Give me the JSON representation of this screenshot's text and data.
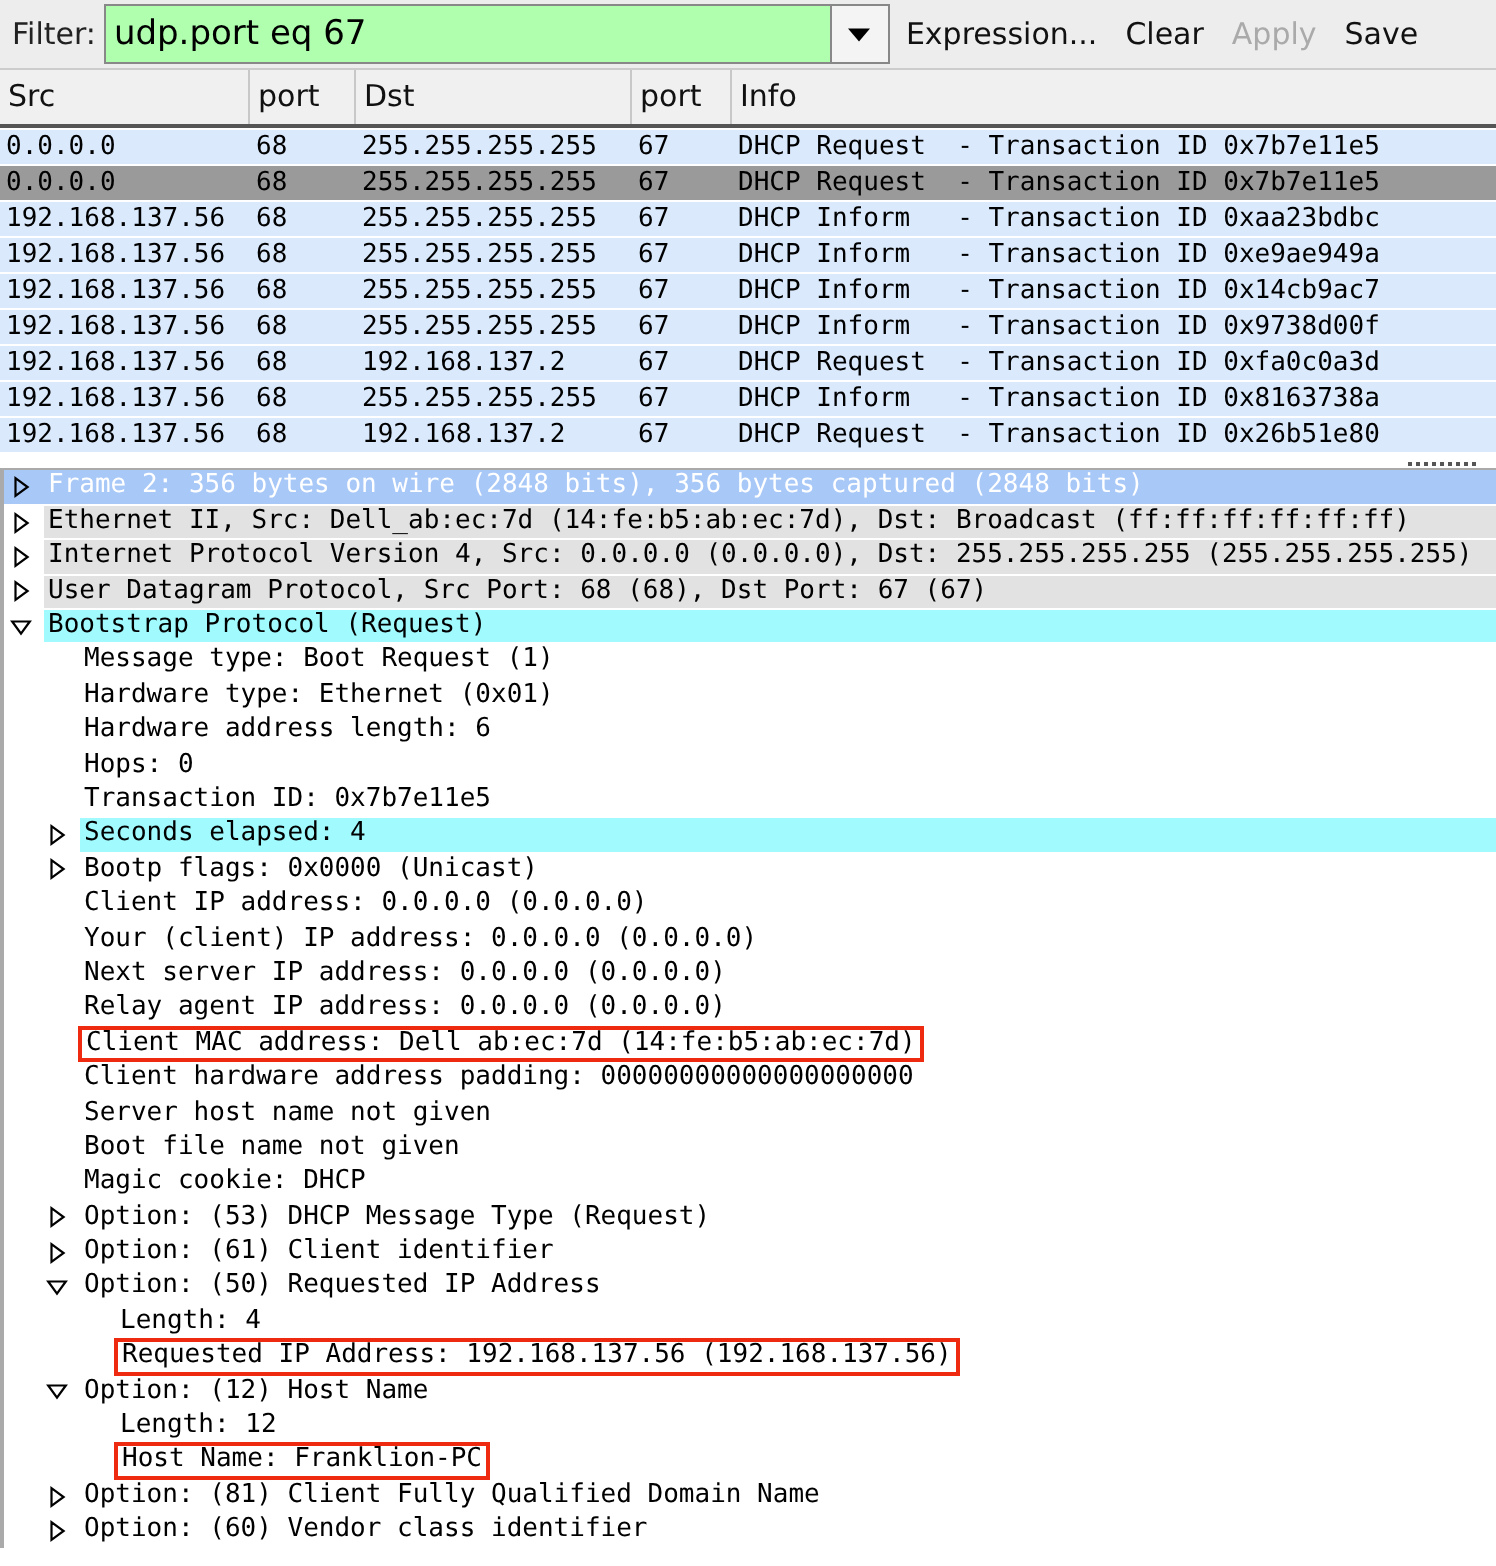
{
  "filter": {
    "label": "Filter:",
    "value": "udp.port eq 67",
    "valid": true,
    "buttons": [
      {
        "label": "Expression...",
        "disabled": false
      },
      {
        "label": "Clear",
        "disabled": false
      },
      {
        "label": "Apply",
        "disabled": true
      },
      {
        "label": "Save",
        "disabled": false
      }
    ]
  },
  "packet_list": {
    "columns": [
      "Src",
      "port",
      "Dst",
      "port",
      "Info"
    ],
    "rows": [
      {
        "cells": [
          "0.0.0.0",
          "68",
          "255.255.255.255",
          "67",
          "DHCP Request  - Transaction ID 0x7b7e11e5"
        ],
        "selected": false
      },
      {
        "cells": [
          "0.0.0.0",
          "68",
          "255.255.255.255",
          "67",
          "DHCP Request  - Transaction ID 0x7b7e11e5"
        ],
        "selected": true
      },
      {
        "cells": [
          "192.168.137.56",
          "68",
          "255.255.255.255",
          "67",
          "DHCP Inform   - Transaction ID 0xaa23bdbc"
        ],
        "selected": false
      },
      {
        "cells": [
          "192.168.137.56",
          "68",
          "255.255.255.255",
          "67",
          "DHCP Inform   - Transaction ID 0xe9ae949a"
        ],
        "selected": false
      },
      {
        "cells": [
          "192.168.137.56",
          "68",
          "255.255.255.255",
          "67",
          "DHCP Inform   - Transaction ID 0x14cb9ac7"
        ],
        "selected": false
      },
      {
        "cells": [
          "192.168.137.56",
          "68",
          "255.255.255.255",
          "67",
          "DHCP Inform   - Transaction ID 0x9738d00f"
        ],
        "selected": false
      },
      {
        "cells": [
          "192.168.137.56",
          "68",
          "192.168.137.2",
          "67",
          "DHCP Request  - Transaction ID 0xfa0c0a3d"
        ],
        "selected": false
      },
      {
        "cells": [
          "192.168.137.56",
          "68",
          "255.255.255.255",
          "67",
          "DHCP Inform   - Transaction ID 0x8163738a"
        ],
        "selected": false
      },
      {
        "cells": [
          "192.168.137.56",
          "68",
          "192.168.137.2",
          "67",
          "DHCP Request  - Transaction ID 0x26b51e80"
        ],
        "selected": false
      }
    ]
  },
  "detail_tree": [
    {
      "text": "Frame 2: 356 bytes on wire (2848 bits), 356 bytes captured (2848 bits)",
      "expanded": false,
      "selected": true,
      "highlighted": false
    },
    {
      "text": "Ethernet II, Src: Dell_ab:ec:7d (14:fe:b5:ab:ec:7d), Dst: Broadcast (ff:ff:ff:ff:ff:ff)",
      "expanded": false,
      "selected": false,
      "highlighted": false
    },
    {
      "text": "Internet Protocol Version 4, Src: 0.0.0.0 (0.0.0.0), Dst: 255.255.255.255 (255.255.255.255)",
      "expanded": false,
      "selected": false,
      "highlighted": false
    },
    {
      "text": "User Datagram Protocol, Src Port: 68 (68), Dst Port: 67 (67)",
      "expanded": false,
      "selected": false,
      "highlighted": false
    },
    {
      "text": "Bootstrap Protocol (Request)",
      "expanded": true,
      "selected": false,
      "highlighted": true,
      "children": [
        {
          "text": "Message type: Boot Request (1)",
          "selected": false,
          "highlighted": false
        },
        {
          "text": "Hardware type: Ethernet (0x01)",
          "selected": false,
          "highlighted": false
        },
        {
          "text": "Hardware address length: 6",
          "selected": false,
          "highlighted": false
        },
        {
          "text": "Hops: 0",
          "selected": false,
          "highlighted": false
        },
        {
          "text": "Transaction ID: 0x7b7e11e5",
          "selected": false,
          "highlighted": false
        },
        {
          "text": "Seconds elapsed: 4",
          "expanded": false,
          "selected": false,
          "highlighted": true
        },
        {
          "text": "Bootp flags: 0x0000 (Unicast)",
          "expanded": false,
          "selected": false,
          "highlighted": false
        },
        {
          "text": "Client IP address: 0.0.0.0 (0.0.0.0)",
          "selected": false,
          "highlighted": false
        },
        {
          "text": "Your (client) IP address: 0.0.0.0 (0.0.0.0)",
          "selected": false,
          "highlighted": false
        },
        {
          "text": "Next server IP address: 0.0.0.0 (0.0.0.0)",
          "selected": false,
          "highlighted": false
        },
        {
          "text": "Relay agent IP address: 0.0.0.0 (0.0.0.0)",
          "selected": false,
          "highlighted": false
        },
        {
          "text": "Client MAC address: Dell ab:ec:7d (14:fe:b5:ab:ec:7d)",
          "selected": false,
          "highlighted": false,
          "boxed": true
        },
        {
          "text": "Client hardware address padding: 00000000000000000000",
          "selected": false,
          "highlighted": false
        },
        {
          "text": "Server host name not given",
          "selected": false,
          "highlighted": false
        },
        {
          "text": "Boot file name not given",
          "selected": false,
          "highlighted": false
        },
        {
          "text": "Magic cookie: DHCP",
          "selected": false,
          "highlighted": false
        },
        {
          "text": "Option: (53) DHCP Message Type (Request)",
          "expanded": false,
          "selected": false,
          "highlighted": false
        },
        {
          "text": "Option: (61) Client identifier",
          "expanded": false,
          "selected": false,
          "highlighted": false
        },
        {
          "text": "Option: (50) Requested IP Address",
          "expanded": true,
          "selected": false,
          "highlighted": false,
          "children": [
            {
              "text": "Length: 4",
              "selected": false,
              "highlighted": false
            },
            {
              "text": "Requested IP Address: 192.168.137.56 (192.168.137.56)",
              "selected": false,
              "highlighted": false,
              "boxed": true
            }
          ]
        },
        {
          "text": "Option: (12) Host Name",
          "expanded": true,
          "selected": false,
          "highlighted": false,
          "children": [
            {
              "text": "Length: 12",
              "selected": false,
              "highlighted": false
            },
            {
              "text": "Host Name: Franklion-PC",
              "selected": false,
              "highlighted": false,
              "boxed": true
            }
          ]
        },
        {
          "text": "Option: (81) Client Fully Qualified Domain Name",
          "expanded": false,
          "selected": false,
          "highlighted": false
        },
        {
          "text": "Option: (60) Vendor class identifier",
          "expanded": false,
          "selected": false,
          "highlighted": false
        }
      ]
    }
  ]
}
